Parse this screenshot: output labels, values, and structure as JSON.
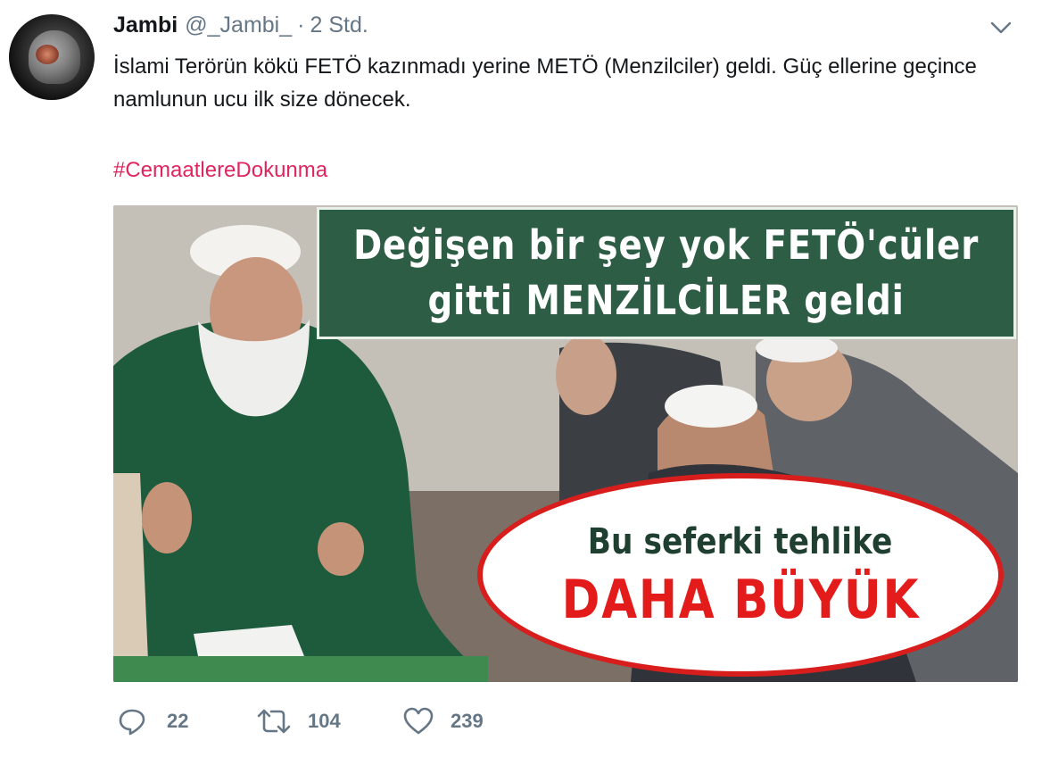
{
  "tweet": {
    "author_name": "Jambi",
    "author_handle": "@_Jambi_",
    "separator": "·",
    "time": "2 Std.",
    "text": "İslami Terörün kökü FETÖ kazınmadı yerine METÖ (Menzilciler) geldi. Güç ellerine geçince namlunun ucu ilk size dönecek.",
    "hashtag": "#CemaatlereDokunma"
  },
  "media": {
    "banner_line1": "Değişen bir şey yok FETÖ'cüler",
    "banner_line2": "gitti MENZİLCİLER geldi",
    "oval_line1": "Bu seferki tehlike",
    "oval_line2": "DAHA BÜYÜK"
  },
  "actions": {
    "replies": "22",
    "retweets": "104",
    "likes": "239"
  },
  "icons": {
    "caret": "chevron-down-icon",
    "reply": "reply-icon",
    "retweet": "retweet-icon",
    "like": "heart-icon"
  },
  "colors": {
    "hashtag": "#e0245e",
    "secondary_text": "#657786",
    "banner_green": "#2e5d45",
    "oval_red": "#e31b1b"
  }
}
